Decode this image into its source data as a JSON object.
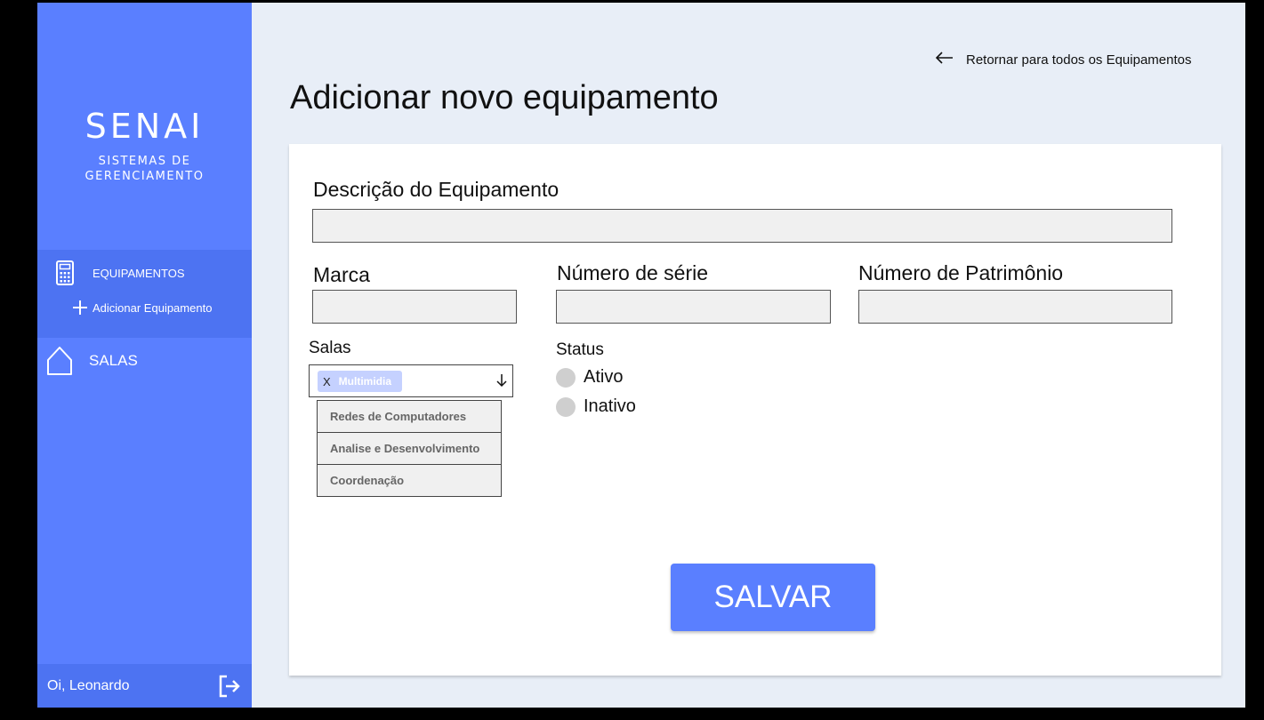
{
  "sidebar": {
    "logo_title": "SENAI",
    "logo_subtitle_line1": "SISTEMAS DE",
    "logo_subtitle_line2": "GERENCIAMENTO",
    "items": [
      {
        "label": "EQUIPAMENTOS",
        "icon": "calculator-icon",
        "active": true
      },
      {
        "label": "Adicionar Equipamento",
        "icon": "plus-icon"
      },
      {
        "label": "SALAS",
        "icon": "house-icon"
      }
    ],
    "user_greeting": "Oi, Leonardo",
    "logout_icon": "logout-icon"
  },
  "header": {
    "back_link": "Retornar para todos os Equipamentos",
    "title": "Adicionar novo equipamento"
  },
  "form": {
    "description_label": "Descrição do Equipamento",
    "description_value": "",
    "brand_label": "Marca",
    "brand_value": "",
    "serial_label": "Número de série",
    "serial_value": "",
    "asset_label": "Número de Patrimônio",
    "asset_value": "",
    "rooms_label": "Salas",
    "rooms_selected": "Multimidia",
    "rooms_chip_remove": "X",
    "rooms_options": [
      "Redes de Computadores",
      "Analise e Desenvolvimento",
      "Coordenação"
    ],
    "status_label": "Status",
    "status_options": [
      "Ativo",
      "Inativo"
    ],
    "save_label": "SALVAR"
  },
  "colors": {
    "sidebar": "#5a7fff",
    "sidebar_active": "#4d73f2",
    "background": "#e8eef7",
    "chip": "#c5d1ff",
    "button": "#5a7fff"
  }
}
